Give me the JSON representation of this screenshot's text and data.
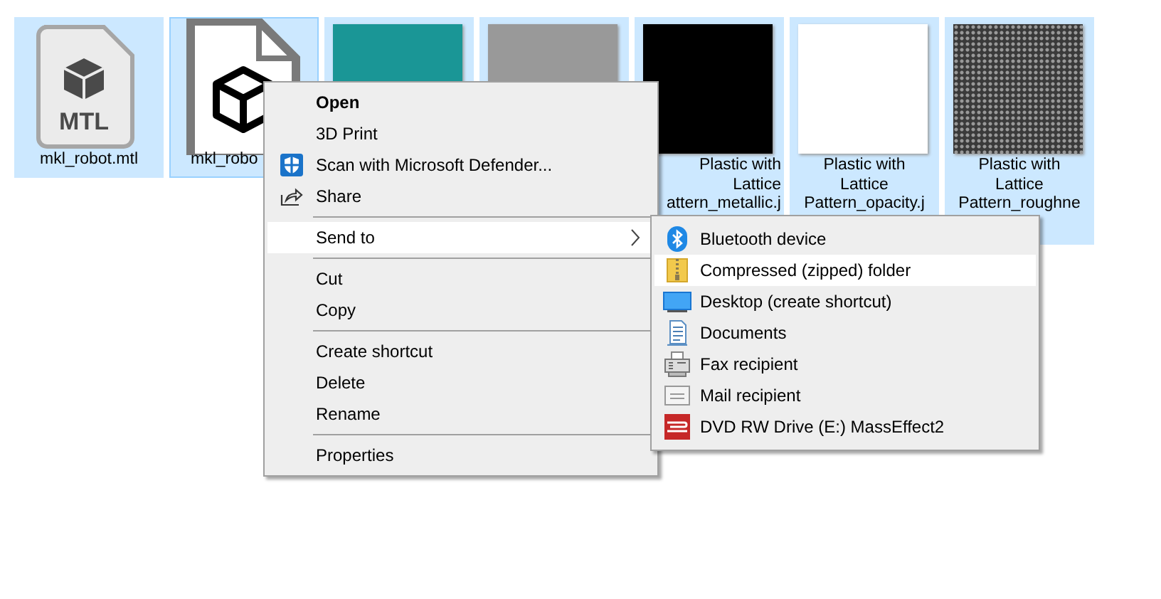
{
  "files": [
    {
      "kind": "mtl",
      "badge": "MTL",
      "label": [
        "mkl_robot.mtl"
      ],
      "selected": true,
      "focused": false
    },
    {
      "kind": "model",
      "label": [
        "mkl_robo"
      ],
      "selected": true,
      "focused": true
    },
    {
      "kind": "thumbnail",
      "color": "#1a9696",
      "selected": true,
      "focused": false
    },
    {
      "kind": "thumbnail",
      "color": "#999999",
      "selected": true,
      "focused": false
    },
    {
      "kind": "thumbnail",
      "color": "#000000",
      "label": [
        "Plastic with",
        "Lattice",
        "attern_metallic.j"
      ],
      "selected": true,
      "focused": false
    },
    {
      "kind": "thumbnail",
      "color": "#ffffff",
      "label": [
        "Plastic with",
        "Lattice",
        "Pattern_opacity.j"
      ],
      "selected": true,
      "focused": false
    },
    {
      "kind": "texture",
      "color": "#3a3a3a",
      "label": [
        "Plastic with",
        "Lattice",
        "Pattern_roughne"
      ],
      "selected": true,
      "focused": false
    }
  ],
  "context_menu": {
    "items": [
      {
        "kind": "command",
        "label": "Open",
        "bold": true,
        "selected": false,
        "submenu": false
      },
      {
        "kind": "command",
        "label": "3D Print",
        "bold": false,
        "selected": false,
        "submenu": false
      },
      {
        "kind": "command",
        "label": "Scan with Microsoft Defender...",
        "bold": false,
        "selected": false,
        "submenu": false
      },
      {
        "kind": "command",
        "label": "Share",
        "bold": false,
        "selected": false,
        "submenu": false
      },
      {
        "kind": "separator"
      },
      {
        "kind": "command",
        "label": "Send to",
        "bold": false,
        "selected": true,
        "submenu": true
      },
      {
        "kind": "separator"
      },
      {
        "kind": "command",
        "label": "Cut",
        "bold": false,
        "selected": false,
        "submenu": false
      },
      {
        "kind": "command",
        "label": "Copy",
        "bold": false,
        "selected": false,
        "submenu": false
      },
      {
        "kind": "separator"
      },
      {
        "kind": "command",
        "label": "Create shortcut",
        "bold": false,
        "selected": false,
        "submenu": false
      },
      {
        "kind": "command",
        "label": "Delete",
        "bold": false,
        "selected": false,
        "submenu": false
      },
      {
        "kind": "command",
        "label": "Rename",
        "bold": false,
        "selected": false,
        "submenu": false
      },
      {
        "kind": "separator"
      },
      {
        "kind": "command",
        "label": "Properties",
        "bold": false,
        "selected": false,
        "submenu": false
      }
    ]
  },
  "send_to_menu": {
    "items": [
      {
        "kind": "command",
        "label": "Bluetooth device",
        "bold": false,
        "selected": false,
        "submenu": false
      },
      {
        "kind": "command",
        "label": "Compressed (zipped) folder",
        "bold": false,
        "selected": true,
        "submenu": false
      },
      {
        "kind": "command",
        "label": "Desktop (create shortcut)",
        "bold": false,
        "selected": false,
        "submenu": false
      },
      {
        "kind": "command",
        "label": "Documents",
        "bold": false,
        "selected": false,
        "submenu": false
      },
      {
        "kind": "command",
        "label": "Fax recipient",
        "bold": false,
        "selected": false,
        "submenu": false
      },
      {
        "kind": "command",
        "label": "Mail recipient",
        "bold": false,
        "selected": false,
        "submenu": false
      },
      {
        "kind": "command",
        "label": "DVD RW Drive (E:) MassEffect2",
        "bold": false,
        "selected": false,
        "submenu": false
      }
    ]
  }
}
